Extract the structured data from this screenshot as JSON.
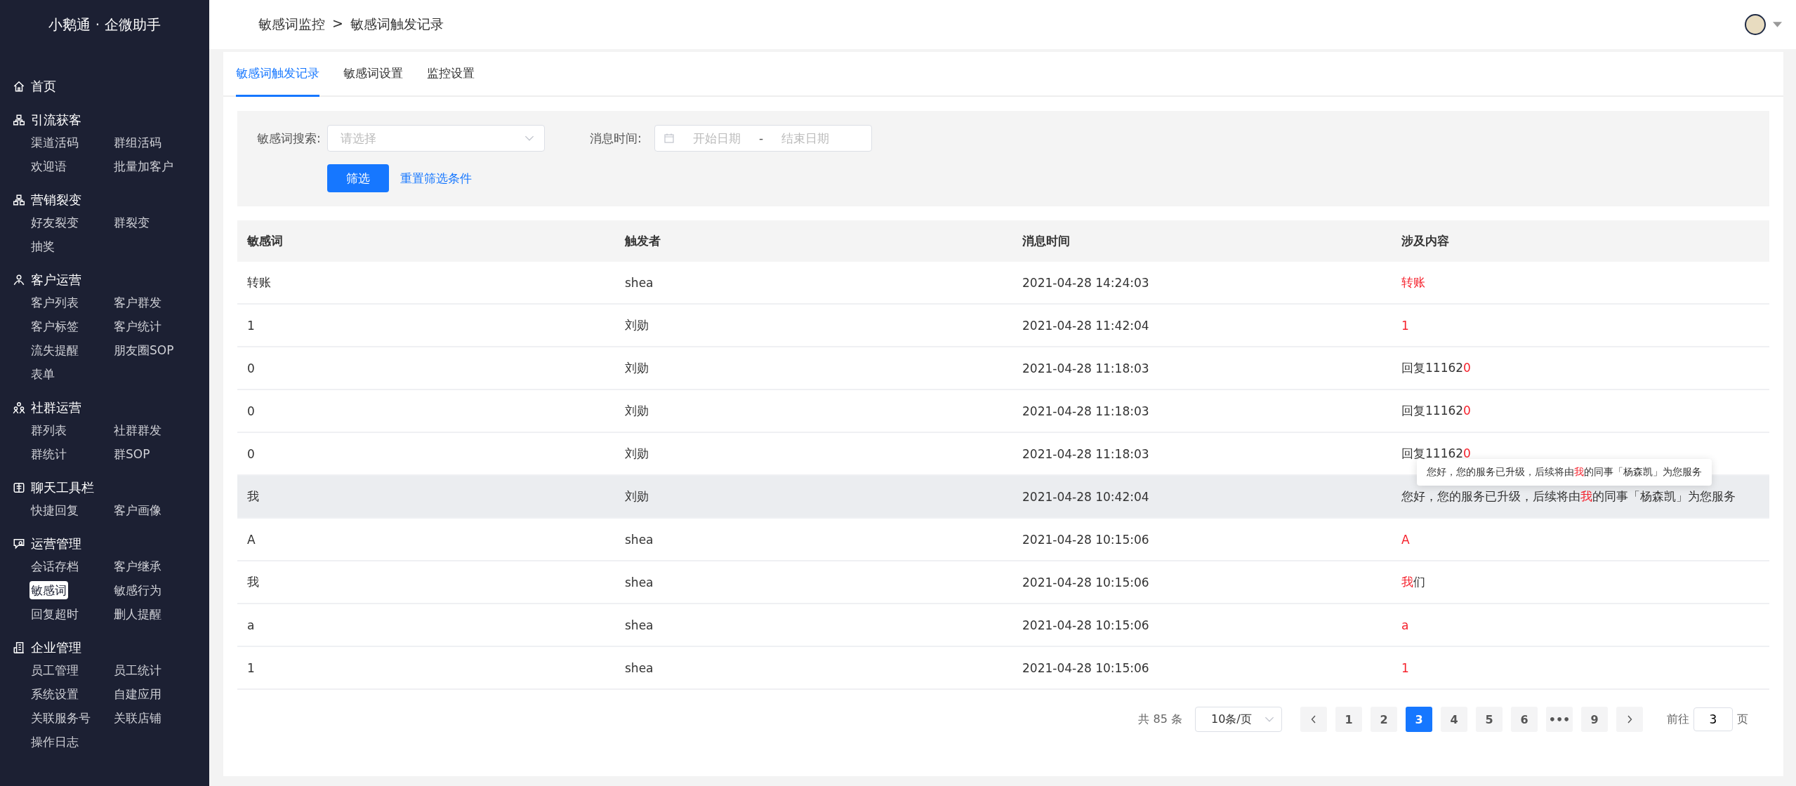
{
  "sidebar": {
    "brand": "小鹅通 · 企微助手",
    "groups": [
      {
        "kind": "home",
        "title": "首页"
      },
      {
        "kind": "flow",
        "title": "引流获客",
        "items": [
          {
            "label": "渠道活码",
            "selected": false
          },
          {
            "label": "群组活码",
            "selected": false
          },
          {
            "label": "欢迎语",
            "selected": false
          },
          {
            "label": "批量加客户",
            "selected": false
          }
        ]
      },
      {
        "kind": "fission",
        "title": "营销裂变",
        "items": [
          {
            "label": "好友裂变",
            "selected": false
          },
          {
            "label": "群裂变",
            "selected": false
          },
          {
            "label": "抽奖",
            "selected": false
          }
        ]
      },
      {
        "kind": "customer",
        "title": "客户运营",
        "items": [
          {
            "label": "客户列表",
            "selected": false
          },
          {
            "label": "客户群发",
            "selected": false
          },
          {
            "label": "客户标签",
            "selected": false
          },
          {
            "label": "客户统计",
            "selected": false
          },
          {
            "label": "流失提醒",
            "selected": false
          },
          {
            "label": "朋友圈SOP",
            "selected": false
          },
          {
            "label": "表单",
            "selected": false
          }
        ]
      },
      {
        "kind": "community",
        "title": "社群运营",
        "items": [
          {
            "label": "群列表",
            "selected": false
          },
          {
            "label": "社群群发",
            "selected": false
          },
          {
            "label": "群统计",
            "selected": false
          },
          {
            "label": "群SOP",
            "selected": false
          }
        ]
      },
      {
        "kind": "toolbar",
        "title": "聊天工具栏",
        "items": [
          {
            "label": "快捷回复",
            "selected": false
          },
          {
            "label": "客户画像",
            "selected": false
          }
        ]
      },
      {
        "kind": "ops",
        "title": "运营管理",
        "items": [
          {
            "label": "会话存档",
            "selected": false
          },
          {
            "label": "客户继承",
            "selected": false
          },
          {
            "label": "敏感词",
            "selected": true
          },
          {
            "label": "敏感行为",
            "selected": false
          },
          {
            "label": "回复超时",
            "selected": false
          },
          {
            "label": "删人提醒",
            "selected": false
          }
        ]
      },
      {
        "kind": "company",
        "title": "企业管理",
        "items": [
          {
            "label": "员工管理",
            "selected": false
          },
          {
            "label": "员工统计",
            "selected": false
          },
          {
            "label": "系统设置",
            "selected": false
          },
          {
            "label": "自建应用",
            "selected": false
          },
          {
            "label": "关联服务号",
            "selected": false
          },
          {
            "label": "关联店铺",
            "selected": false
          },
          {
            "label": "操作日志",
            "selected": false
          }
        ]
      }
    ]
  },
  "breadcrumb": [
    "敏感词监控",
    "敏感词触发记录"
  ],
  "breadcrumb_separator": ">",
  "tabs": [
    {
      "label": "敏感词触发记录",
      "selected": true
    },
    {
      "label": "敏感词设置",
      "selected": false
    },
    {
      "label": "监控设置",
      "selected": false
    }
  ],
  "filters": {
    "keyword_label": "敏感词搜索:",
    "keyword_placeholder": "请选择",
    "time_label": "消息时间:",
    "start_placeholder": "开始日期",
    "range_separator": "-",
    "end_placeholder": "结束日期",
    "submit": "筛选",
    "reset": "重置筛选条件"
  },
  "table": {
    "columns": [
      "敏感词",
      "触发者",
      "消息时间",
      "涉及内容"
    ],
    "rows": [
      {
        "word": "转账",
        "sender": "shea",
        "time": "2021-04-28 14:24:03",
        "hovered": false,
        "content": [
          {
            "text": "转账",
            "hit": true
          }
        ]
      },
      {
        "word": "1",
        "sender": "刘勋",
        "time": "2021-04-28 11:42:04",
        "hovered": false,
        "content": [
          {
            "text": "1",
            "hit": true
          }
        ]
      },
      {
        "word": "0",
        "sender": "刘勋",
        "time": "2021-04-28 11:18:03",
        "hovered": false,
        "content": [
          {
            "text": "回复11162",
            "hit": false
          },
          {
            "text": "0",
            "hit": true
          }
        ]
      },
      {
        "word": "0",
        "sender": "刘勋",
        "time": "2021-04-28 11:18:03",
        "hovered": false,
        "content": [
          {
            "text": "回复11162",
            "hit": false
          },
          {
            "text": "0",
            "hit": true
          }
        ]
      },
      {
        "word": "0",
        "sender": "刘勋",
        "time": "2021-04-28 11:18:03",
        "hovered": false,
        "content": [
          {
            "text": "回复11162",
            "hit": false
          },
          {
            "text": "0",
            "hit": true
          }
        ]
      },
      {
        "word": "我",
        "sender": "刘勋",
        "time": "2021-04-28 10:42:04",
        "hovered": true,
        "content": [
          {
            "text": "您好，您的服务已升级，后续将由",
            "hit": false
          },
          {
            "text": "我",
            "hit": true
          },
          {
            "text": "的同事「杨森凯」为您服务",
            "hit": false
          }
        ],
        "tooltip": [
          {
            "text": "您好，您的服务已升级，后续将由",
            "hit": false
          },
          {
            "text": "我",
            "hit": true
          },
          {
            "text": "的同事「杨森凯」为您服务",
            "hit": false
          }
        ]
      },
      {
        "word": "A",
        "sender": "shea",
        "time": "2021-04-28 10:15:06",
        "hovered": false,
        "content": [
          {
            "text": "A",
            "hit": true
          }
        ]
      },
      {
        "word": "我",
        "sender": "shea",
        "time": "2021-04-28 10:15:06",
        "hovered": false,
        "content": [
          {
            "text": "我",
            "hit": true
          },
          {
            "text": "们",
            "hit": false
          }
        ]
      },
      {
        "word": "a",
        "sender": "shea",
        "time": "2021-04-28 10:15:06",
        "hovered": false,
        "content": [
          {
            "text": "a",
            "hit": true
          }
        ]
      },
      {
        "word": "1",
        "sender": "shea",
        "time": "2021-04-28 10:15:06",
        "hovered": false,
        "content": [
          {
            "text": "1",
            "hit": true
          }
        ]
      }
    ]
  },
  "pagination": {
    "total": "共 85 条",
    "page_size": "10条/页",
    "pages": [
      {
        "label": "1",
        "selected": false
      },
      {
        "label": "2",
        "selected": false
      },
      {
        "label": "3",
        "selected": true
      },
      {
        "label": "4",
        "selected": false
      },
      {
        "label": "5",
        "selected": false
      },
      {
        "label": "6",
        "selected": false
      },
      {
        "label": "•••",
        "selected": false
      },
      {
        "label": "9",
        "selected": false
      }
    ],
    "goto_label": "前往",
    "goto_value": "3",
    "goto_suffix": "页"
  }
}
